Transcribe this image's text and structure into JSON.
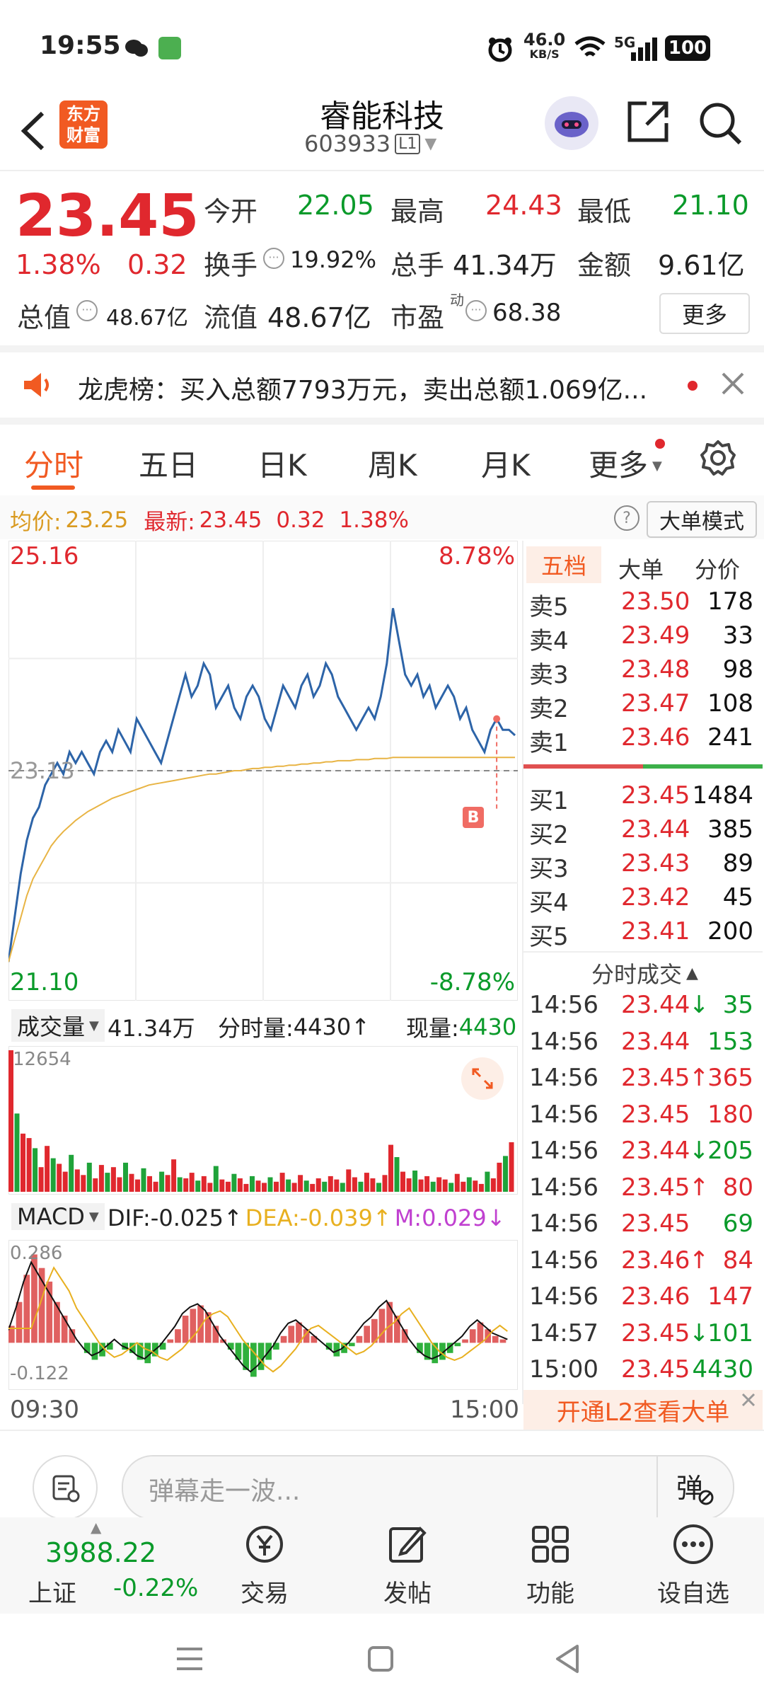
{
  "status_bar": {
    "time": "19:55",
    "net_speed": "46.0",
    "net_unit": "KB/S",
    "signal": "5G",
    "battery": "100"
  },
  "header": {
    "brand_line1": "东方",
    "brand_line2": "财富",
    "stock_name": "睿能科技",
    "stock_code": "603933",
    "level": "L1"
  },
  "quote": {
    "price": "23.45",
    "change_pct": "1.38%",
    "change": "0.32",
    "open_label": "今开",
    "open": "22.05",
    "high_label": "最高",
    "high": "24.43",
    "low_label": "最低",
    "low": "21.10",
    "turnover_label": "换手",
    "turnover": "19.92%",
    "volume_label": "总手",
    "volume": "41.34万",
    "amount_label": "金额",
    "amount": "9.61亿",
    "mktcap_label": "总值",
    "mktcap": "48.67亿",
    "float_label": "流值",
    "float_cap": "48.67亿",
    "pe_label": "市盈",
    "pe_sup": "动",
    "pe": "68.38",
    "more_label": "更多"
  },
  "notice": {
    "text": "龙虎榜：买入总额7793万元，卖出总额1.069亿..."
  },
  "tabs": [
    "分时",
    "五日",
    "日K",
    "周K",
    "月K",
    "更多"
  ],
  "avg_bar": {
    "avg_label": "均价:",
    "avg": "23.25",
    "latest_label": "最新:",
    "latest": "23.45",
    "chg": "0.32",
    "pct": "1.38%",
    "mode_button": "大单模式"
  },
  "chart_data": {
    "type": "line",
    "title": "",
    "y_top": "25.16",
    "y_bottom": "21.10",
    "pct_top": "8.78%",
    "pct_bottom": "-8.78%",
    "ref_price": "23.13",
    "ylim": [
      21.1,
      25.16
    ],
    "ref_value": 23.13,
    "x_start": "09:30",
    "x_end": "15:00",
    "series": [
      {
        "name": "",
        "color": "#2d64a8",
        "values": [
          21.4,
          21.8,
          22.2,
          22.5,
          22.7,
          22.8,
          23.0,
          23.1,
          23.2,
          23.1,
          23.3,
          23.2,
          23.3,
          23.2,
          23.1,
          23.3,
          23.4,
          23.3,
          23.5,
          23.4,
          23.3,
          23.6,
          23.5,
          23.4,
          23.3,
          23.2,
          23.4,
          23.6,
          23.8,
          24.0,
          23.8,
          23.9,
          24.1,
          24.0,
          23.7,
          23.8,
          23.9,
          23.7,
          23.6,
          23.8,
          23.9,
          23.8,
          23.6,
          23.5,
          23.7,
          23.9,
          23.8,
          23.7,
          23.9,
          24.0,
          23.8,
          23.9,
          24.1,
          24.0,
          23.8,
          23.7,
          23.6,
          23.5,
          23.6,
          23.7,
          23.6,
          23.8,
          24.1,
          24.6,
          24.3,
          24.0,
          23.9,
          24.0,
          23.8,
          23.9,
          23.7,
          23.8,
          23.9,
          23.8,
          23.6,
          23.7,
          23.5,
          23.4,
          23.3,
          23.5,
          23.6,
          23.5,
          23.5,
          23.45
        ]
      },
      {
        "name": "",
        "color": "#e8b444",
        "values": [
          21.4,
          21.6,
          21.8,
          22.0,
          22.15,
          22.25,
          22.35,
          22.45,
          22.52,
          22.58,
          22.63,
          22.68,
          22.72,
          22.76,
          22.79,
          22.82,
          22.85,
          22.88,
          22.9,
          22.92,
          22.94,
          22.96,
          22.98,
          23.0,
          23.01,
          23.02,
          23.03,
          23.04,
          23.05,
          23.06,
          23.07,
          23.08,
          23.09,
          23.1,
          23.1,
          23.11,
          23.12,
          23.13,
          23.13,
          23.14,
          23.15,
          23.15,
          23.16,
          23.16,
          23.17,
          23.17,
          23.18,
          23.18,
          23.19,
          23.19,
          23.2,
          23.2,
          23.21,
          23.21,
          23.22,
          23.22,
          23.22,
          23.23,
          23.23,
          23.23,
          23.24,
          23.24,
          23.24,
          23.25,
          23.25,
          23.25,
          23.25,
          23.25,
          23.25,
          23.25,
          23.25,
          23.25,
          23.25,
          23.25,
          23.25,
          23.25,
          23.25,
          23.25,
          23.25,
          23.25,
          23.25,
          23.25,
          23.25,
          23.25
        ]
      }
    ],
    "marker": "B",
    "volume_values": [
      12654,
      7000,
      5200,
      4800,
      3900,
      2200,
      4100,
      3000,
      2500,
      1800,
      3300,
      2000,
      1500,
      2600,
      1200,
      2400,
      1700,
      2200,
      1300,
      2600,
      1600,
      1100,
      2100,
      1400,
      900,
      1800,
      1500,
      2900,
      1300,
      1200,
      1700,
      1000,
      1400,
      800,
      2300,
      1100,
      900,
      1600,
      1200,
      700,
      1400,
      1000,
      800,
      1300,
      900,
      1700,
      1100,
      800,
      1500,
      1000,
      700,
      1200,
      900,
      1400,
      1100,
      800,
      2000,
      1300,
      900,
      1700,
      1200,
      800,
      1500,
      4200,
      3100,
      1800,
      1200,
      1900,
      1100,
      1400,
      900,
      1300,
      1100,
      800,
      1600,
      900,
      1300,
      1000,
      700,
      1800,
      1200,
      2600,
      3200,
      4430
    ],
    "volume_max_label": "12654",
    "macd_values": [
      0.05,
      0.12,
      0.2,
      0.26,
      0.22,
      0.18,
      0.12,
      0.08,
      0.04,
      0.0,
      -0.03,
      -0.05,
      -0.04,
      -0.02,
      0.0,
      -0.02,
      -0.03,
      -0.05,
      -0.06,
      -0.04,
      -0.02,
      0.01,
      0.04,
      0.08,
      0.1,
      0.11,
      0.09,
      0.05,
      0.01,
      -0.02,
      -0.05,
      -0.08,
      -0.1,
      -0.08,
      -0.05,
      -0.02,
      0.02,
      0.05,
      0.06,
      0.04,
      0.02,
      0.0,
      -0.02,
      -0.04,
      -0.03,
      -0.01,
      0.02,
      0.05,
      0.07,
      0.1,
      0.12,
      0.08,
      0.04,
      0.0,
      -0.03,
      -0.05,
      -0.06,
      -0.05,
      -0.03,
      -0.01,
      0.01,
      0.04,
      0.06,
      0.04,
      0.02,
      0.01,
      0.0
    ],
    "macd_top": "0.286",
    "macd_bottom": "-0.122"
  },
  "volume_bar": {
    "label": "成交量",
    "total": "41.34万",
    "minute_label": "分时量:",
    "minute": "4430",
    "now_label": "现量:",
    "now": "4430"
  },
  "macd_bar": {
    "label": "MACD",
    "dif": "DIF:-0.025",
    "dea": "DEA:-0.039",
    "m": "M:0.029"
  },
  "order_book": {
    "tabs": [
      "五档",
      "大单",
      "分价"
    ],
    "asks": [
      {
        "label": "卖5",
        "price": "23.50",
        "vol": "178"
      },
      {
        "label": "卖4",
        "price": "23.49",
        "vol": "33"
      },
      {
        "label": "卖3",
        "price": "23.48",
        "vol": "98"
      },
      {
        "label": "卖2",
        "price": "23.47",
        "vol": "108"
      },
      {
        "label": "卖1",
        "price": "23.46",
        "vol": "241"
      }
    ],
    "bids": [
      {
        "label": "买1",
        "price": "23.45",
        "vol": "1484"
      },
      {
        "label": "买2",
        "price": "23.44",
        "vol": "385"
      },
      {
        "label": "买3",
        "price": "23.43",
        "vol": "89"
      },
      {
        "label": "买4",
        "price": "23.42",
        "vol": "45"
      },
      {
        "label": "买5",
        "price": "23.41",
        "vol": "200"
      }
    ]
  },
  "ticks": {
    "title": "分时成交",
    "rows": [
      {
        "time": "14:56",
        "price": "23.44",
        "arrow": "↓",
        "vol": "35",
        "dir": "green"
      },
      {
        "time": "14:56",
        "price": "23.44",
        "arrow": "",
        "vol": "153",
        "dir": "green"
      },
      {
        "time": "14:56",
        "price": "23.45",
        "arrow": "↑",
        "vol": "365",
        "dir": "red"
      },
      {
        "time": "14:56",
        "price": "23.45",
        "arrow": "",
        "vol": "180",
        "dir": "red"
      },
      {
        "time": "14:56",
        "price": "23.44",
        "arrow": "↓",
        "vol": "205",
        "dir": "green"
      },
      {
        "time": "14:56",
        "price": "23.45",
        "arrow": "↑",
        "vol": "80",
        "dir": "red"
      },
      {
        "time": "14:56",
        "price": "23.45",
        "arrow": "",
        "vol": "69",
        "dir": "green"
      },
      {
        "time": "14:56",
        "price": "23.46",
        "arrow": "↑",
        "vol": "84",
        "dir": "red"
      },
      {
        "time": "14:56",
        "price": "23.46",
        "arrow": "",
        "vol": "147",
        "dir": "red"
      },
      {
        "time": "14:57",
        "price": "23.45",
        "arrow": "↓",
        "vol": "101",
        "dir": "green"
      },
      {
        "time": "15:00",
        "price": "23.45",
        "arrow": "",
        "vol": "4430",
        "dir": "green"
      }
    ],
    "l2_banner": "开通L2查看大单"
  },
  "comment": {
    "placeholder": "弹幕走一波..."
  },
  "bottom_nav": {
    "index_value": "3988.22",
    "index_name": "上证",
    "index_pct": "-0.22%",
    "items": [
      "交易",
      "发帖",
      "功能",
      "设自选"
    ]
  }
}
